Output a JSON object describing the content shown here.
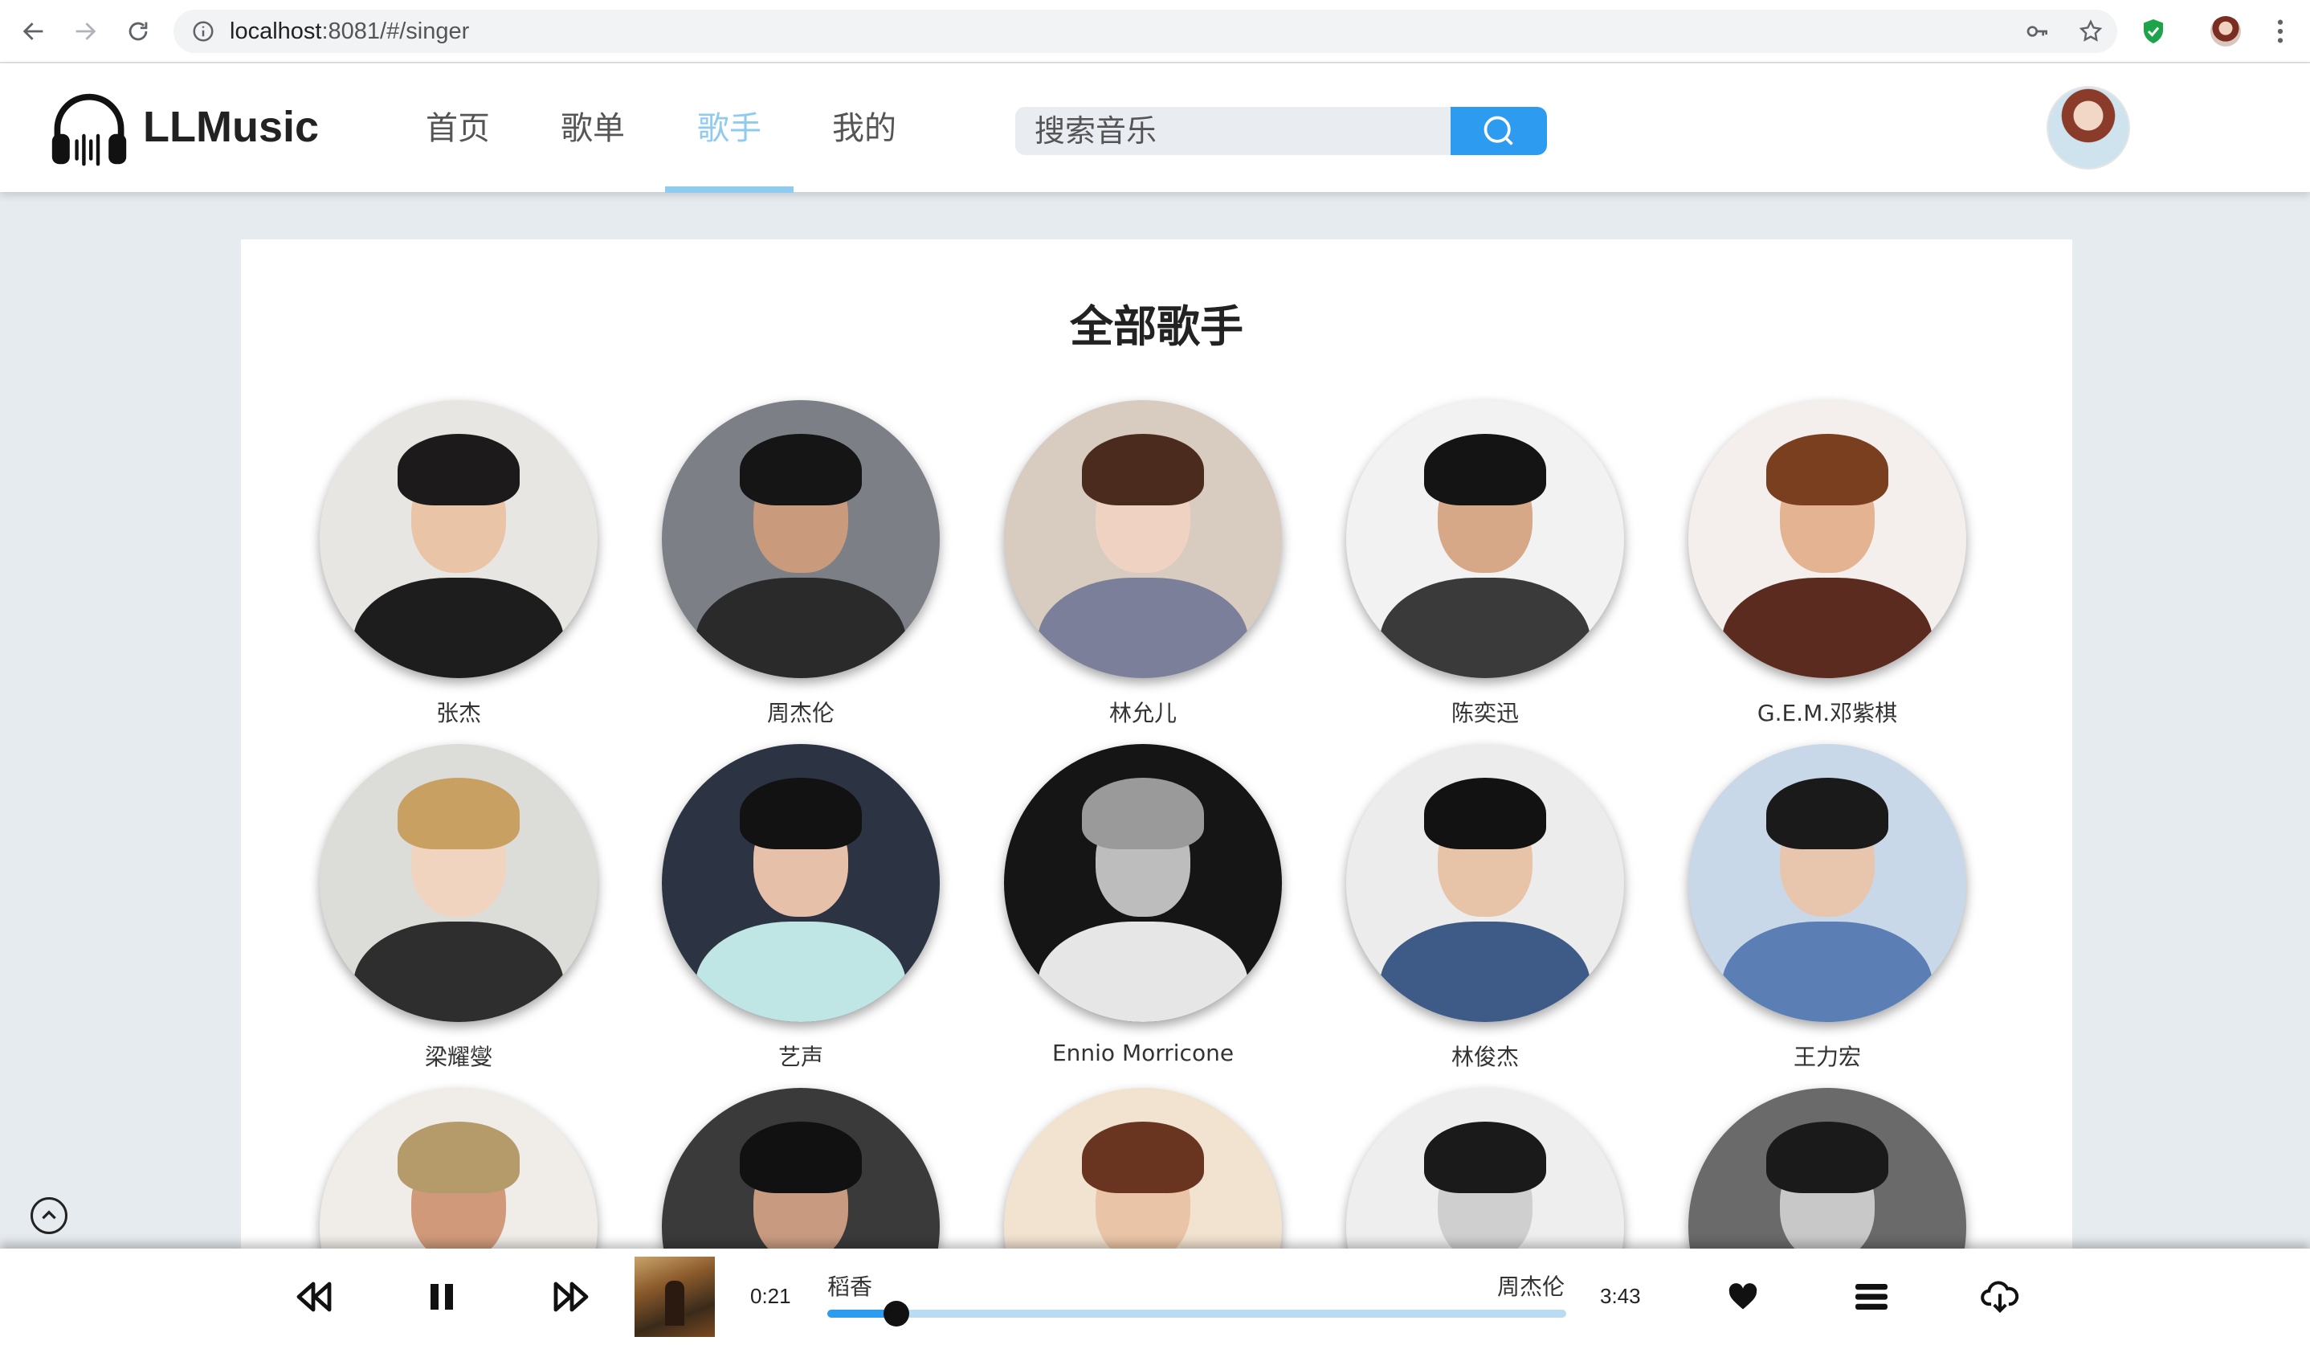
{
  "browser": {
    "url_host": "localhost",
    "url_rest": ":8081/#/singer"
  },
  "app": {
    "logo_text": "LLMusic",
    "nav": [
      {
        "label": "首页",
        "active": false
      },
      {
        "label": "歌单",
        "active": false
      },
      {
        "label": "歌手",
        "active": true
      },
      {
        "label": "我的",
        "active": false
      }
    ],
    "search_placeholder": "搜索音乐"
  },
  "content": {
    "title": "全部歌手",
    "singers": [
      {
        "name": "张杰",
        "bg": "#e8e6e2",
        "skin": "#e9c4a6",
        "hair": "#1c1a1a",
        "cloth": "#1d1d1d"
      },
      {
        "name": "周杰伦",
        "bg": "#7c7f86",
        "skin": "#c99a7c",
        "hair": "#151515",
        "cloth": "#2a2a2a"
      },
      {
        "name": "林允儿",
        "bg": "#d8cbc0",
        "skin": "#efd2c2",
        "hair": "#4a2b1e",
        "cloth": "#7c7f9a"
      },
      {
        "name": "陈奕迅",
        "bg": "#f2f2f2",
        "skin": "#d7a887",
        "hair": "#141414",
        "cloth": "#3a3a3a"
      },
      {
        "name": "G.E.M.邓紫棋",
        "bg": "#f4efec",
        "skin": "#e3b392",
        "hair": "#7a3f1f",
        "cloth": "#5a2b1e"
      },
      {
        "name": "梁耀燮",
        "bg": "#dcdcd8",
        "skin": "#f0d4c0",
        "hair": "#c8a062",
        "cloth": "#2e2e2e"
      },
      {
        "name": "艺声",
        "bg": "#2c3444",
        "skin": "#e6c0a8",
        "hair": "#121212",
        "cloth": "#bfe6e4"
      },
      {
        "name": "Ennio Morricone",
        "bg": "#151515",
        "skin": "#bdbdbd",
        "hair": "#9a9a9a",
        "cloth": "#e6e6e6"
      },
      {
        "name": "林俊杰",
        "bg": "#ececec",
        "skin": "#e7c3a8",
        "hair": "#121212",
        "cloth": "#3e5a86"
      },
      {
        "name": "王力宏",
        "bg": "#c9d8e8",
        "skin": "#e8c6ae",
        "hair": "#1a1a1a",
        "cloth": "#5b7fb5"
      },
      {
        "name": "",
        "bg": "#f0ece8",
        "skin": "#d09a7a",
        "hair": "#b59a6a",
        "cloth": "#7a4a2a"
      },
      {
        "name": "",
        "bg": "#3a3a3a",
        "skin": "#c89a80",
        "hair": "#111111",
        "cloth": "#1e1e1e"
      },
      {
        "name": "",
        "bg": "#f2e2d0",
        "skin": "#eac4a6",
        "hair": "#6a3520",
        "cloth": "#c98a6a"
      },
      {
        "name": "",
        "bg": "#eeeeee",
        "skin": "#cfcfcf",
        "hair": "#1a1a1a",
        "cloth": "#888888"
      },
      {
        "name": "",
        "bg": "#6a6a6a",
        "skin": "#c8c8c8",
        "hair": "#1a1a1a",
        "cloth": "#2a2a2a"
      }
    ]
  },
  "player": {
    "current_time": "0:21",
    "total_time": "3:43",
    "song_title": "稻香",
    "artist": "周杰伦",
    "progress_fraction": 0.094
  },
  "colors": {
    "accent": "#2d9cf0",
    "nav_active": "#8ecbef"
  }
}
